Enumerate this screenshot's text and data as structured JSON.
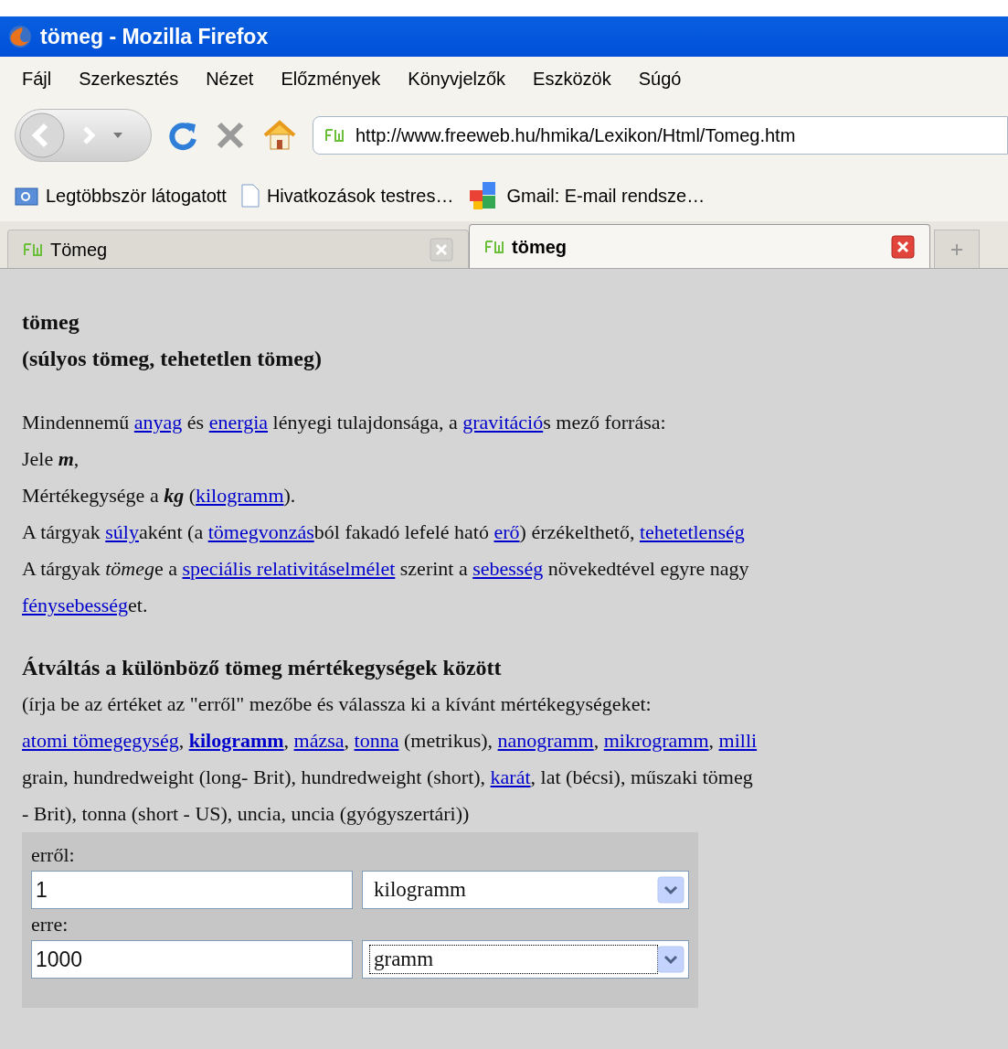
{
  "window": {
    "title": "tömeg - Mozilla Firefox"
  },
  "menu": [
    "Fájl",
    "Szerkesztés",
    "Nézet",
    "Előzmények",
    "Könyvjelzők",
    "Eszközök",
    "Súgó"
  ],
  "address_bar": {
    "value": "http://www.freeweb.hu/hmika/Lexikon/Html/Tomeg.htm"
  },
  "bookmarks": [
    "Legtöbbször látogatott",
    "Hivatkozások testres…",
    "Gmail: E-mail rendsze…"
  ],
  "tabs": [
    {
      "label": "Tömeg",
      "selected": false
    },
    {
      "label": "tömeg",
      "selected": true
    }
  ],
  "page": {
    "heading": [
      "tömeg",
      "(súlyos tömeg, tehetetlen tömeg)"
    ],
    "intro": [
      [
        {
          "kind": "text",
          "text": "Mindennemű "
        },
        {
          "kind": "link",
          "text": "anyag"
        },
        {
          "kind": "text",
          "text": " és "
        },
        {
          "kind": "link",
          "text": "energia"
        },
        {
          "kind": "text",
          "text": " lényegi tulajdonsága, a "
        },
        {
          "kind": "link",
          "text": "gravitáció"
        },
        {
          "kind": "text",
          "text": "s mező forrása:"
        }
      ],
      [
        {
          "kind": "text",
          "text": "Jele "
        },
        {
          "kind": "bold_italic",
          "text": "m"
        },
        {
          "kind": "text",
          "text": ","
        }
      ],
      [
        {
          "kind": "text",
          "text": "Mértékegysége a "
        },
        {
          "kind": "bold_italic",
          "text": "kg"
        },
        {
          "kind": "text",
          "text": " ("
        },
        {
          "kind": "link",
          "text": "kilogramm"
        },
        {
          "kind": "text",
          "text": ")."
        }
      ],
      [
        {
          "kind": "text",
          "text": "A tárgyak "
        },
        {
          "kind": "link",
          "text": "súly"
        },
        {
          "kind": "text",
          "text": "aként (a "
        },
        {
          "kind": "link",
          "text": "tömegvonzás"
        },
        {
          "kind": "text",
          "text": "ból fakadó lefelé ható "
        },
        {
          "kind": "link",
          "text": "erő"
        },
        {
          "kind": "text",
          "text": ") érzékelthető, "
        },
        {
          "kind": "link",
          "text": "tehetetlenség"
        }
      ],
      [
        {
          "kind": "text",
          "text": "A tárgyak "
        },
        {
          "kind": "italic",
          "text": "tömeg"
        },
        {
          "kind": "text",
          "text": "e a "
        },
        {
          "kind": "link",
          "text": "speciális relativitáselmélet"
        },
        {
          "kind": "text",
          "text": " szerint a "
        },
        {
          "kind": "link",
          "text": "sebesség"
        },
        {
          "kind": "text",
          "text": " növekedtével egyre nagy"
        }
      ],
      [
        {
          "kind": "link",
          "text": "fénysebesség"
        },
        {
          "kind": "text",
          "text": "et."
        }
      ]
    ],
    "converter_heading": "Átváltás a különböző tömeg mértékegységek között",
    "converter_text": [
      [
        {
          "kind": "text",
          "text": "(írja be az értéket az \"erről\" mezőbe és válassza ki a kívánt mértékegységeket:"
        }
      ],
      [
        {
          "kind": "link",
          "text": "atomi tömegegység"
        },
        {
          "kind": "text",
          "text": ", "
        },
        {
          "kind": "bold_link",
          "text": "kilogramm"
        },
        {
          "kind": "text",
          "text": ", "
        },
        {
          "kind": "link",
          "text": "mázsa"
        },
        {
          "kind": "text",
          "text": ", "
        },
        {
          "kind": "link",
          "text": "tonna"
        },
        {
          "kind": "text",
          "text": " (metrikus), "
        },
        {
          "kind": "link",
          "text": "nanogramm"
        },
        {
          "kind": "text",
          "text": ", "
        },
        {
          "kind": "link",
          "text": "mikrogramm"
        },
        {
          "kind": "text",
          "text": ", "
        },
        {
          "kind": "link",
          "text": "milli"
        }
      ],
      [
        {
          "kind": "text",
          "text": "grain, hundredweight (long- Brit), hundredweight (short), "
        },
        {
          "kind": "link",
          "text": "karát"
        },
        {
          "kind": "text",
          "text": ", lat (bécsi), műszaki tömeg"
        }
      ],
      [
        {
          "kind": "text",
          "text": "- Brit), tonna (short - US), uncia, uncia (gyógyszertári))"
        }
      ]
    ],
    "form": [
      {
        "label": "erről:",
        "value": "1",
        "unit": "kilogramm",
        "focused": false
      },
      {
        "label": "erre:",
        "value": "1000",
        "unit": "gramm",
        "focused": true
      }
    ]
  }
}
